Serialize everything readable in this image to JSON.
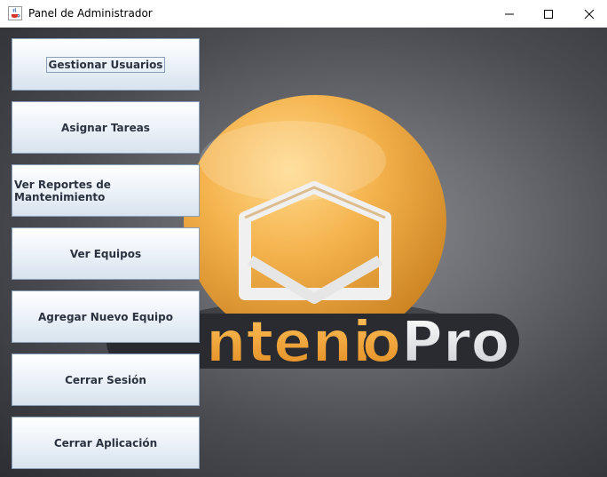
{
  "window": {
    "title": "Panel de Administrador",
    "app_icon": "java-coffee-icon",
    "controls": [
      "minimize-icon",
      "maximize-icon",
      "close-icon"
    ]
  },
  "background_logo": {
    "text_orange": "nteni",
    "text_o": "o",
    "text_white": "Pro",
    "icon": "envelope-icon",
    "colors": {
      "orange": "#f2a33a",
      "white": "#e8e8e8",
      "dark_bg": "#3a3b40"
    }
  },
  "menu": {
    "buttons": [
      {
        "label": "Gestionar Usuarios"
      },
      {
        "label": "Asignar Tareas"
      },
      {
        "label": "Ver Reportes de Mantenimiento"
      },
      {
        "label": "Ver Equipos"
      },
      {
        "label": "Agregar Nuevo Equipo"
      },
      {
        "label": "Cerrar Sesión"
      },
      {
        "label": "Cerrar Aplicación"
      }
    ]
  }
}
